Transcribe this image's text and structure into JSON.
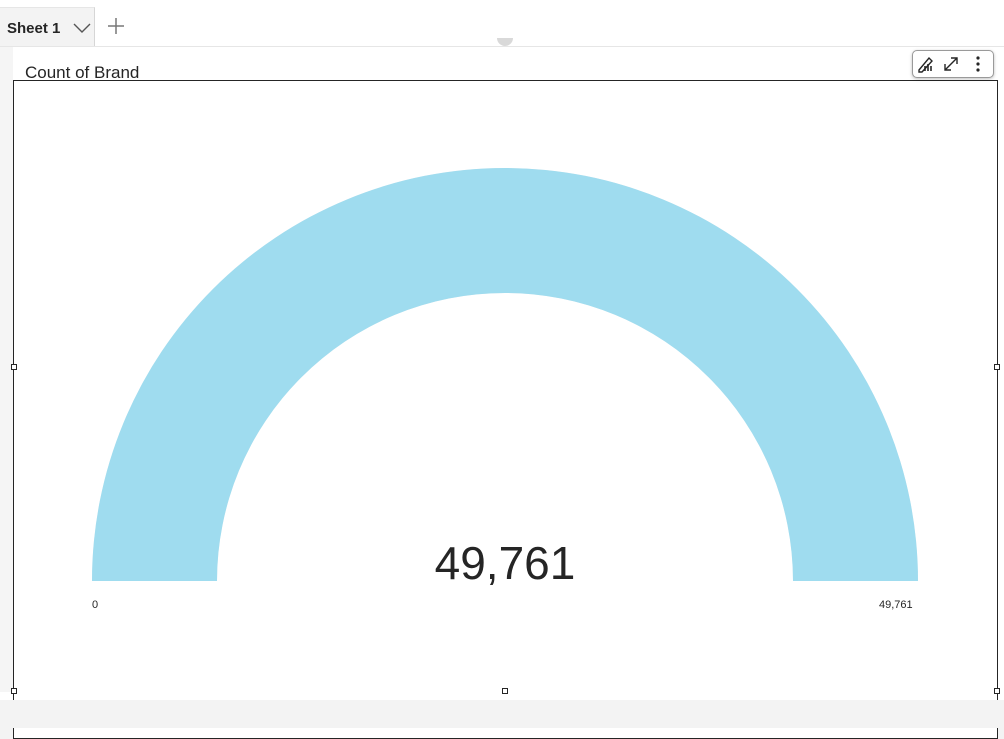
{
  "tabs": {
    "active_sheet": "Sheet 1"
  },
  "icons": {
    "chevron": "chevron-down-icon",
    "add": "plus-icon",
    "format": "format-visual-icon",
    "expand": "expand-icon",
    "more": "more-options-icon"
  },
  "visual": {
    "title": "Count of Brand",
    "value_display": "49,761",
    "min_label": "0",
    "max_label": "49,761"
  },
  "chart_data": {
    "type": "gauge",
    "value": 49761,
    "min": 0,
    "max": 49761,
    "fill_fraction": 1.0,
    "title": "Count of Brand",
    "arc_color": "#9fdcef"
  },
  "colors": {
    "arc": "#9fdcef",
    "text": "#252525",
    "canvas": "#ffffff",
    "background": "#f3f3f3"
  }
}
